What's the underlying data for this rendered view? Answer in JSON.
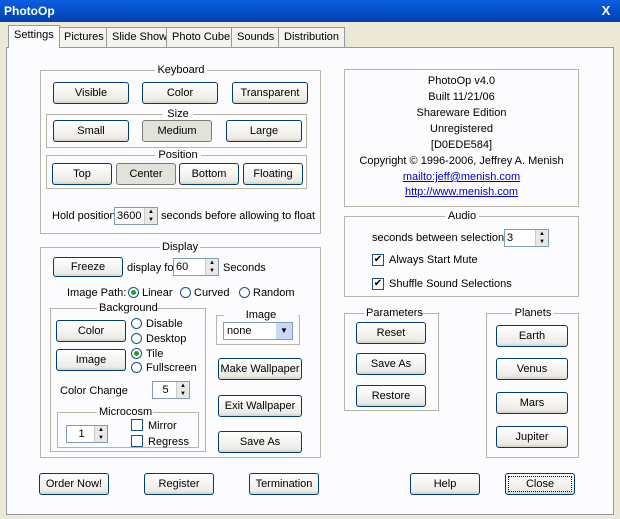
{
  "window": {
    "title": "PhotoOp",
    "close_glyph": "X"
  },
  "tabs": [
    {
      "label": "Settings"
    },
    {
      "label": "Pictures"
    },
    {
      "label": "Slide Show"
    },
    {
      "label": "Photo Cube"
    },
    {
      "label": "Sounds"
    },
    {
      "label": "Distribution"
    }
  ],
  "keyboard": {
    "title": "Keyboard",
    "visible": "Visible",
    "color": "Color",
    "transparent": "Transparent",
    "size_title": "Size",
    "small": "Small",
    "medium": "Medium",
    "large": "Large",
    "position_title": "Position",
    "top": "Top",
    "center": "Center",
    "bottom": "Bottom",
    "floating": "Floating",
    "hold_label": "Hold position",
    "hold_value": "3600",
    "hold_suffix": "seconds before allowing to float"
  },
  "display": {
    "title": "Display",
    "freeze": "Freeze",
    "display_for": "display for",
    "display_value": "60",
    "seconds": "Seconds",
    "image_path_label": "Image Path:",
    "linear": "Linear",
    "curved": "Curved",
    "random": "Random",
    "background_title": "Background",
    "color_btn": "Color",
    "image_btn": "Image",
    "disable": "Disable",
    "desktop": "Desktop",
    "tile": "Tile",
    "fullscreen": "Fullscreen",
    "color_change_label": "Color Change",
    "color_change_value": "5",
    "microcosm_title": "Microcosm",
    "microcosm_value": "1",
    "mirror": "Mirror",
    "regress": "Regress",
    "rotation_title": "Image Rotation",
    "rotation_value": "none",
    "make_wallpaper": "Make Wallpaper",
    "exit_wallpaper": "Exit Wallpaper",
    "save_as": "Save As"
  },
  "about": {
    "lines": [
      "PhotoOp v4.0",
      "Built 11/21/06",
      "Shareware Edition",
      "Unregistered",
      "[D0EDE584]",
      "Copyright © 1996-2006, Jeffrey A. Menish"
    ],
    "mail": "mailto:jeff@menish.com",
    "url": "http://www.menish.com"
  },
  "audio": {
    "title": "Audio",
    "between_label": "seconds between selections",
    "between_value": "3",
    "always_mute": "Always Start Mute",
    "shuffle": "Shuffle Sound Selections"
  },
  "parameters": {
    "title": "Parameters",
    "reset": "Reset",
    "save_as": "Save As",
    "restore": "Restore"
  },
  "planets": {
    "title": "Planets",
    "earth": "Earth",
    "venus": "Venus",
    "mars": "Mars",
    "jupiter": "Jupiter"
  },
  "bottom": {
    "order": "Order Now!",
    "register": "Register",
    "termination": "Termination",
    "help": "Help",
    "close": "Close"
  },
  "colors": {
    "titlebar": "#0a5fe0",
    "link": "#0000cc",
    "radio_dot": "#21a121"
  }
}
